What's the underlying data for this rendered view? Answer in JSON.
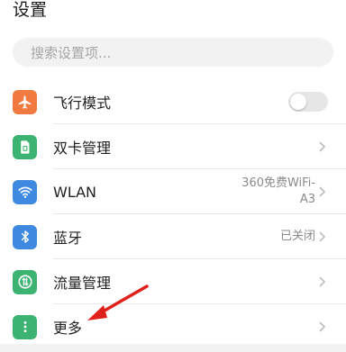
{
  "header": {
    "title": "设置"
  },
  "search": {
    "placeholder": "搜索设置项..."
  },
  "colors": {
    "airplane": "#f07a40",
    "sim": "#3cb371",
    "wlan": "#3f8ae0",
    "bluetooth": "#3f8ae0",
    "data": "#3cb371",
    "more": "#3cb371",
    "annotation_arrow": "#e0201a"
  },
  "settings": {
    "items": [
      {
        "label": "飞行模式",
        "icon": "airplane-icon",
        "control": "toggle",
        "toggle_on": false
      },
      {
        "label": "双卡管理",
        "icon": "sim-card-icon",
        "control": "chevron"
      },
      {
        "label": "WLAN",
        "icon": "wifi-icon",
        "control": "chevron",
        "value_line1": "360免费WiFi-",
        "value_line2": "A3"
      },
      {
        "label": "蓝牙",
        "icon": "bluetooth-icon",
        "control": "chevron",
        "value_line1": "已关闭"
      },
      {
        "label": "流量管理",
        "icon": "data-usage-icon",
        "control": "chevron"
      },
      {
        "label": "更多",
        "icon": "more-dots-icon",
        "control": "chevron"
      }
    ]
  }
}
